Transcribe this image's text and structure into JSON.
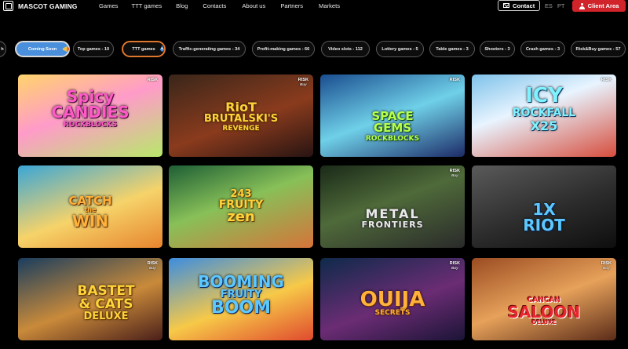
{
  "header": {
    "brand": "MASCOT GAMING",
    "nav": [
      "Games",
      "TTT games",
      "Blog",
      "Contacts",
      "About us",
      "Partners",
      "Markets"
    ],
    "contact_label": "Contact",
    "languages": [
      "ES",
      "PT"
    ],
    "client_area_label": "Client Area"
  },
  "filters": [
    {
      "label": "h",
      "style": "normal"
    },
    {
      "label": "Coming Soon",
      "style": "coming"
    },
    {
      "label": "Top games - 10",
      "style": "normal"
    },
    {
      "label": "TTT games",
      "style": "ttt"
    },
    {
      "label": "Traffic-generating games - 34",
      "style": "normal"
    },
    {
      "label": "Profit-making games - 66",
      "style": "normal"
    },
    {
      "label": "Video slots - 112",
      "style": "normal"
    },
    {
      "label": "Lottery games - 5",
      "style": "normal"
    },
    {
      "label": "Table games - 3",
      "style": "normal"
    },
    {
      "label": "Shooters - 3",
      "style": "normal"
    },
    {
      "label": "Crash games - 3",
      "style": "normal"
    },
    {
      "label": "Risk&Buy games - 57",
      "style": "normal"
    }
  ],
  "games": [
    {
      "line1": "Spicy",
      "line2": "CANDIES",
      "line3": "ROCKBLOCKS",
      "badge": "RISK",
      "badge_sub": "",
      "art": "a1",
      "tone": "t-pink"
    },
    {
      "line1": "RioT",
      "line2": "BRUTALSKI'S",
      "line3": "REVENGE",
      "badge": "RISK",
      "badge_sub": "Buy",
      "art": "a2",
      "tone": "t-gold"
    },
    {
      "line1": "SPACE",
      "line2": "GEMS",
      "line3": "ROCKBLOCKS",
      "badge": "RISK",
      "badge_sub": "",
      "art": "a3",
      "tone": "t-green"
    },
    {
      "line1": "ICY",
      "line2": "ROCKFALL",
      "line3": "X25",
      "badge": "RISK",
      "badge_sub": "",
      "art": "a4",
      "tone": "t-cyan"
    },
    {
      "line1": "CATCH",
      "line2": "the",
      "line3": "WIN",
      "badge": "",
      "badge_sub": "",
      "art": "a5",
      "tone": "t-orange"
    },
    {
      "line1": "243",
      "line2": "FRUITY",
      "line3": "zen",
      "badge": "",
      "badge_sub": "",
      "art": "a6",
      "tone": "t-gold"
    },
    {
      "line1": "",
      "line2": "METAL",
      "line3": "FRONTIERS",
      "badge": "RISK",
      "badge_sub": "Buy",
      "art": "a7",
      "tone": "t-silver"
    },
    {
      "line1": "1X",
      "line2": "RIOT",
      "line3": "",
      "badge": "",
      "badge_sub": "",
      "art": "a8",
      "tone": "t-blue"
    },
    {
      "line1": "BASTET",
      "line2": "& CATS",
      "line3": "DELUXE",
      "badge": "RISK",
      "badge_sub": "Buy",
      "art": "a9",
      "tone": "t-gold"
    },
    {
      "line1": "BOOMING",
      "line2": "FRUITY",
      "line3": "BOOM",
      "badge": "",
      "badge_sub": "",
      "art": "a10",
      "tone": "t-blue"
    },
    {
      "line1": "",
      "line2": "OUIJA",
      "line3": "SECRETS",
      "badge": "RISK",
      "badge_sub": "Buy",
      "art": "a11",
      "tone": "t-orange"
    },
    {
      "line1": "CANCAN",
      "line2": "SALOON",
      "line3": "DELUXE",
      "badge": "RISK",
      "badge_sub": "Buy",
      "art": "a12",
      "tone": "t-red"
    }
  ]
}
